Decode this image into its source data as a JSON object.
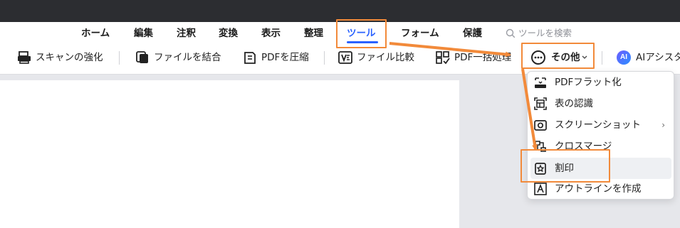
{
  "tabs": [
    {
      "label": "ホーム"
    },
    {
      "label": "編集"
    },
    {
      "label": "注釈"
    },
    {
      "label": "変換"
    },
    {
      "label": "表示"
    },
    {
      "label": "整理"
    },
    {
      "label": "ツール",
      "active": true
    },
    {
      "label": "フォーム"
    },
    {
      "label": "保護"
    }
  ],
  "search": {
    "placeholder": "ツールを検索",
    "icon": "search-icon"
  },
  "toolbar": {
    "scan": "スキャンの強化",
    "combine": "ファイルを結合",
    "compress": "PDFを圧縮",
    "compare": "ファイル比較",
    "batch": "PDF一括処理",
    "more": "その他",
    "ai": "AIアシスタ",
    "ai_badge": "AI"
  },
  "menu": {
    "items": [
      {
        "label": "PDFフラット化",
        "icon": "flatten-icon"
      },
      {
        "label": "表の認識",
        "icon": "table-recognition-icon"
      },
      {
        "label": "スクリーンショット",
        "icon": "screenshot-icon",
        "submenu": true
      },
      {
        "label": "クロスマージ",
        "icon": "cross-merge-icon"
      },
      {
        "label": "割印",
        "icon": "seal-icon",
        "hovered": true
      },
      {
        "label": "アウトラインを作成",
        "icon": "outline-icon"
      }
    ],
    "submenu_glyph": "›"
  },
  "colors": {
    "accent": "#2a62ff",
    "highlight": "#f28a3a",
    "titlebar": "#2c2d31"
  }
}
